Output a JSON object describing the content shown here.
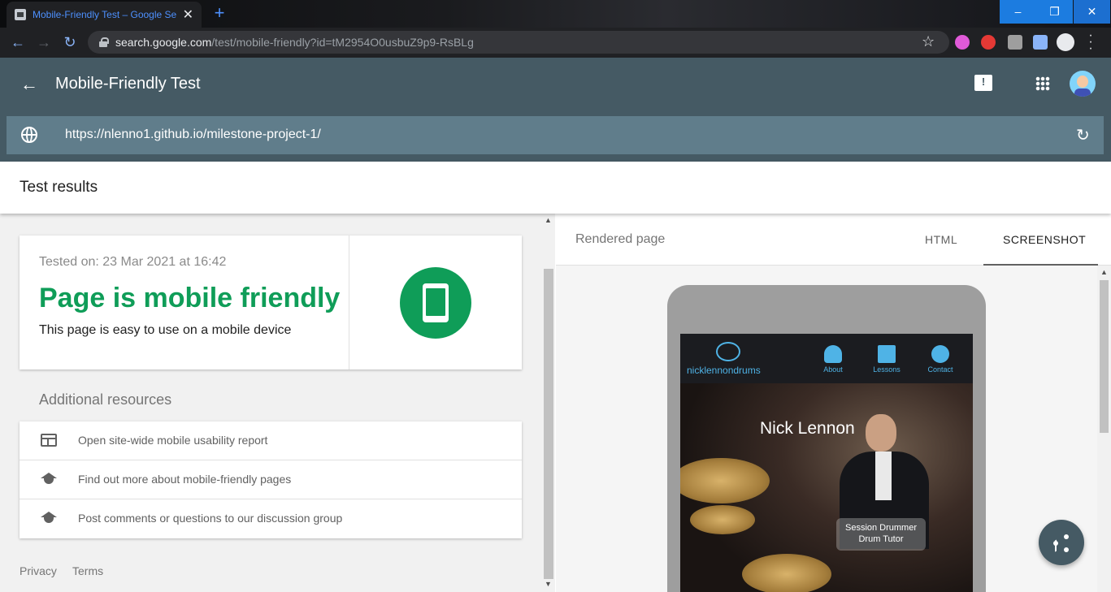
{
  "browser": {
    "tab_title": "Mobile-Friendly Test – Google Se",
    "new_tab": "+",
    "tab_close": "✕",
    "url_host": "search.google.com",
    "url_path": "/test/mobile-friendly?id=tM2954O0usbuZ9p9-RsBLg",
    "window": {
      "minimize": "–",
      "restore": "❐",
      "close": "✕"
    },
    "nav": {
      "back": "←",
      "forward": "→",
      "reload": "↻"
    },
    "star": "☆"
  },
  "app": {
    "title": "Mobile-Friendly Test",
    "back": "←",
    "feedback": "!",
    "tested_url": "https://nlenno1.github.io/milestone-project-1/",
    "refresh": "↻"
  },
  "results": {
    "title": "Test results",
    "tested_on": "Tested on: 23 Mar 2021 at 16:42",
    "verdict": "Page is mobile friendly",
    "verdict_sub": "This page is easy to use on a mobile device",
    "verdict_color": "#0f9d58"
  },
  "additional": {
    "title": "Additional resources",
    "items": [
      {
        "label": "Open site-wide mobile usability report",
        "icon": "web-icon"
      },
      {
        "label": "Find out more about mobile-friendly pages",
        "icon": "school-icon"
      },
      {
        "label": "Post comments or questions to our discussion group",
        "icon": "school-icon"
      }
    ]
  },
  "footer": {
    "privacy": "Privacy",
    "terms": "Terms"
  },
  "right": {
    "rendered_label": "Rendered page",
    "tab_html": "HTML",
    "tab_screenshot": "SCREENSHOT"
  },
  "site": {
    "logo_text": "nicklennondrums",
    "nav": [
      "About",
      "Lessons",
      "Contact"
    ],
    "hero_name": "Nick Lennon",
    "pill_line1": "Session Drummer",
    "pill_line2": "Drum Tutor"
  },
  "colors": {
    "header": "#455a64",
    "urlbar": "#607d8b",
    "accent": "#0f9d58"
  }
}
